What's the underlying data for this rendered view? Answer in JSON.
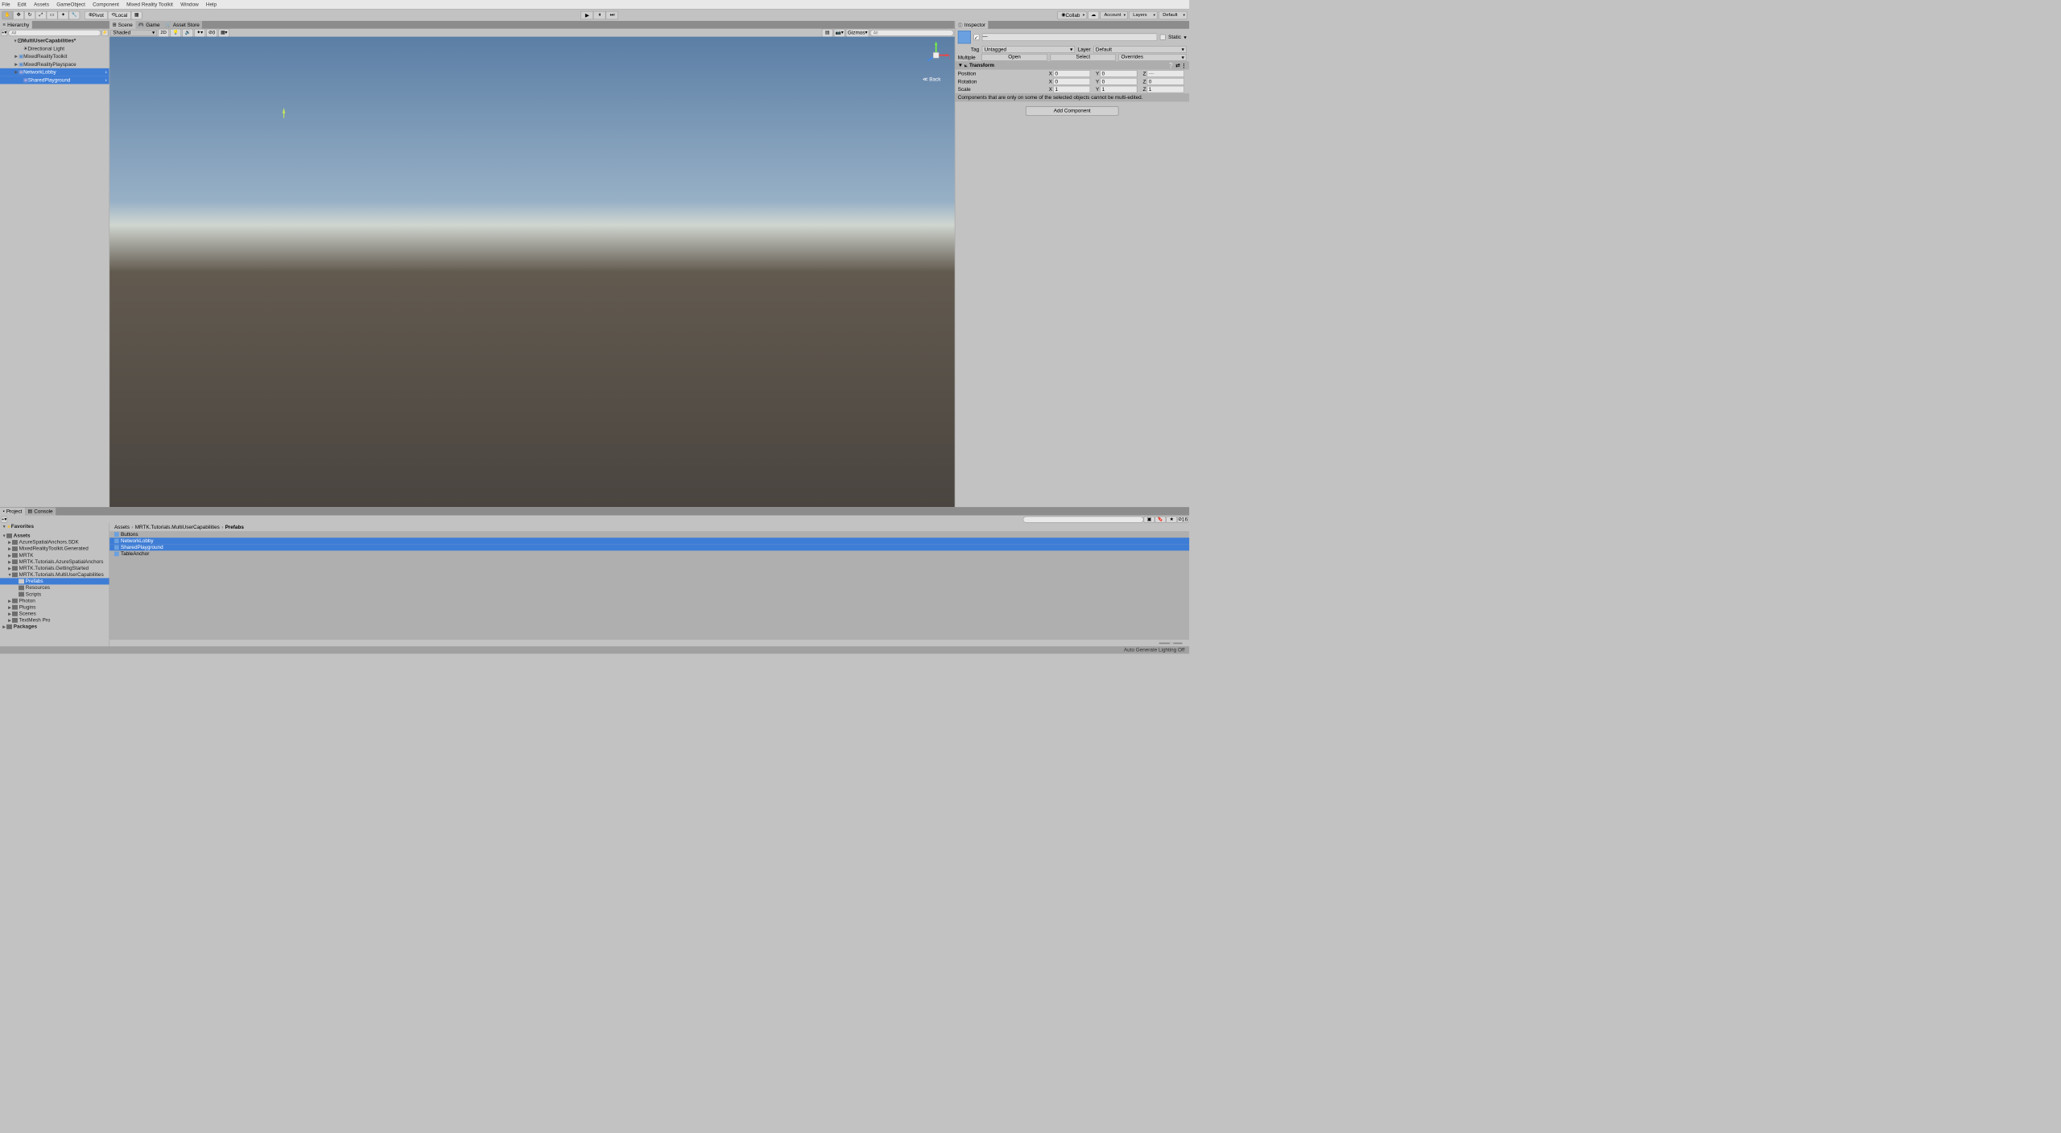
{
  "menubar": [
    "File",
    "Edit",
    "Assets",
    "GameObject",
    "Component",
    "Mixed Reality Toolkit",
    "Window",
    "Help"
  ],
  "toolbar": {
    "pivot": "Pivot",
    "local": "Local",
    "collab": "Collab",
    "account": "Account",
    "layers": "Layers",
    "layout": "Default"
  },
  "hierarchy": {
    "tab": "Hierarchy",
    "search_ph": "All",
    "scene": "MultiUserCapabilities*",
    "items": [
      "Directional Light",
      "MixedRealityToolkit",
      "MixedRealityPlayspace",
      "NetworkLobby",
      "SharedPlayground"
    ]
  },
  "scene_tabs": {
    "scene": "Scene",
    "game": "Game",
    "asset_store": "Asset Store"
  },
  "scene_tools": {
    "shaded": "Shaded",
    "twod": "2D",
    "hidden": "0",
    "gizmos": "Gizmos",
    "search_ph": "All",
    "back": "Back"
  },
  "inspector": {
    "tab": "Inspector",
    "static": "Static",
    "name": "—",
    "tag": "Tag",
    "tag_val": "Untagged",
    "layer": "Layer",
    "layer_val": "Default",
    "multiple": "Multiple",
    "open": "Open",
    "select": "Select",
    "overrides": "Overrides",
    "transform": "Transform",
    "position": "Position",
    "rotation": "Rotation",
    "scale": "Scale",
    "pos": {
      "x": "0",
      "y": "0",
      "z": ""
    },
    "rot": {
      "x": "0",
      "y": "0",
      "z": "0"
    },
    "scl": {
      "x": "1",
      "y": "1",
      "z": "1"
    },
    "warn": "Components that are only on some of the selected objects cannot be multi-edited.",
    "add_comp": "Add Component"
  },
  "project": {
    "tab_project": "Project",
    "tab_console": "Console",
    "slider_val": "16",
    "favorites": "Favorites",
    "assets": "Assets",
    "packages": "Packages",
    "folders": [
      "AzureSpatialAnchors.SDK",
      "MixedRealityToolkit.Generated",
      "MRTK",
      "MRTK.Tutorials.AzureSpatialAnchors",
      "MRTK.Tutorials.GettingStarted",
      "MRTK.Tutorials.MultiUserCapabilities"
    ],
    "sub_folders": [
      "Prefabs",
      "Resources",
      "Scripts"
    ],
    "more_folders": [
      "Photon",
      "Plugins",
      "Scenes",
      "TextMesh Pro"
    ],
    "breadcrumb": [
      "Assets",
      "MRTK.Tutorials.MultiUserCapabilities",
      "Prefabs"
    ],
    "files": [
      "Buttons",
      "NetworkLobby",
      "SharedPlayground",
      "TableAnchor"
    ]
  },
  "status": "Auto Generate Lighting Off"
}
